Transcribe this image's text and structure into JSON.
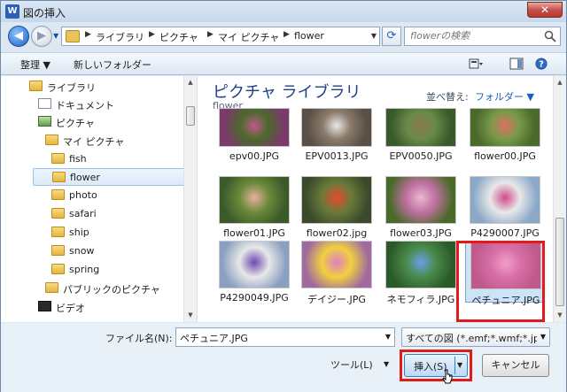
{
  "window": {
    "title": "図の挿入",
    "app_icon": "W"
  },
  "address": {
    "crumbs": [
      "ライブラリ",
      "ピクチャ",
      "マイ ピクチャ",
      "flower"
    ],
    "search_placeholder": "flowerの検索"
  },
  "toolbar": {
    "organize": "整理 ▼",
    "new_folder": "新しいフォルダー"
  },
  "nav": [
    {
      "label": "ライブラリ",
      "icon": "library-icon"
    },
    {
      "label": "ドキュメント",
      "icon": "document-icon"
    },
    {
      "label": "ピクチャ",
      "icon": "picture-library-icon"
    },
    {
      "label": "マイ ピクチャ",
      "icon": "folder-icon"
    },
    {
      "label": "fish",
      "icon": "folder-icon"
    },
    {
      "label": "flower",
      "icon": "folder-icon",
      "selected": true
    },
    {
      "label": "photo",
      "icon": "folder-icon"
    },
    {
      "label": "safari",
      "icon": "folder-icon"
    },
    {
      "label": "ship",
      "icon": "folder-icon"
    },
    {
      "label": "snow",
      "icon": "folder-icon"
    },
    {
      "label": "spring",
      "icon": "folder-icon"
    },
    {
      "label": "パブリックのピクチャ",
      "icon": "folder-icon"
    },
    {
      "label": "ビデオ",
      "icon": "video-icon"
    }
  ],
  "content": {
    "title": "ピクチャ ライブラリ",
    "subtitle": "flower",
    "sort_label": "並べ替え:",
    "sort_value": "フォルダー ▼",
    "files": [
      {
        "name": "epv00.JPG",
        "c1": "#7a3a6a",
        "c2": "#c0588a",
        "c3": "#4a6a2a"
      },
      {
        "name": "EPV0013.JPG",
        "c1": "#5a5048",
        "c2": "#e8e8e8",
        "c3": "#8a7a6a"
      },
      {
        "name": "EPV0050.JPG",
        "c1": "#3a5a2a",
        "c2": "#8a7a4a",
        "c3": "#6a8a4a"
      },
      {
        "name": "flower00.JPG",
        "c1": "#4a6a2a",
        "c2": "#e07060",
        "c3": "#7a9a4a"
      },
      {
        "name": "flower01.JPG",
        "c1": "#3a5a2a",
        "c2": "#e8b0a0",
        "c3": "#6a8a3a"
      },
      {
        "name": "flower02.jpg",
        "c1": "#3a4a2a",
        "c2": "#e84a2a",
        "c3": "#6a7a3a"
      },
      {
        "name": "flower03.JPG",
        "c1": "#4a6a2a",
        "c2": "#e8b8d0",
        "c3": "#c070a0"
      },
      {
        "name": "P4290007.JPG",
        "c1": "#8aa8c8",
        "c2": "#d04a8a",
        "c3": "#e8e8e8"
      },
      {
        "name": "P4290049.JPG",
        "c1": "#8aa0c0",
        "c2": "#6a4ab0",
        "c3": "#e8e8e8"
      },
      {
        "name": "デイジー.JPG",
        "c1": "#a06aa0",
        "c2": "#e080c0",
        "c3": "#f0d040"
      },
      {
        "name": "ネモフィラ.JPG",
        "c1": "#2a5a2a",
        "c2": "#6aa0e8",
        "c3": "#4a8a4a"
      },
      {
        "name": "ペチュニア.JPG",
        "c1": "#c05a8a",
        "c2": "#f0a0c8",
        "c3": "#d870a8",
        "selected": true
      }
    ]
  },
  "bottom": {
    "filename_label": "ファイル名(N):",
    "filename_value": "ペチュニア.JPG",
    "filter_value": "すべての図 (*.emf;*.wmf;*.jpg",
    "tools_label": "ツール(L)",
    "insert_label": "挿入(S)",
    "cancel_label": "キャンセル"
  },
  "colors": {
    "accent": "#1a5fc1",
    "highlight": "#e11b1b"
  }
}
